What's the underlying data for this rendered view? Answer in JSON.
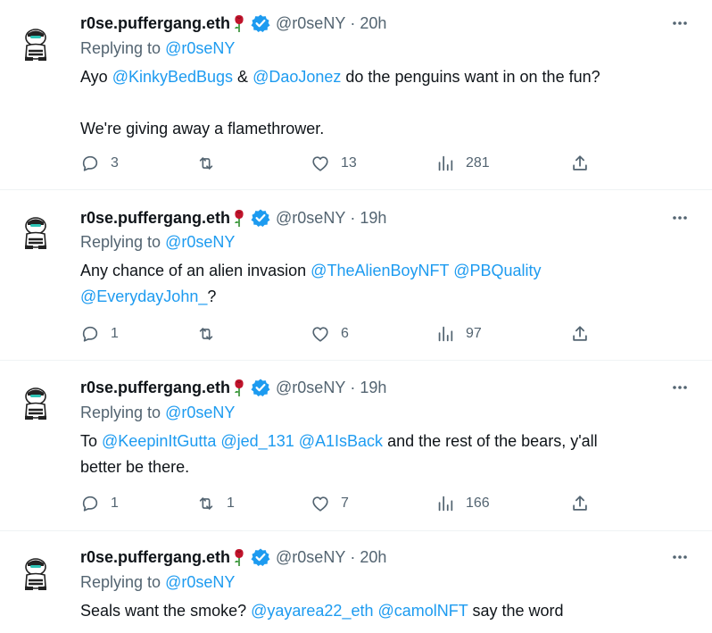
{
  "tweets": [
    {
      "name": "r0se.puffergang.eth",
      "handle": "@r0seNY",
      "dot": "·",
      "time": "20h",
      "replying_label": "Replying to ",
      "replying_to": "@r0seNY",
      "body_parts": [
        {
          "t": "Ayo "
        },
        {
          "t": "@KinkyBedBugs",
          "m": true
        },
        {
          "t": " & "
        },
        {
          "t": "@DaoJonez",
          "m": true
        },
        {
          "t": " do the penguins want in on the fun?"
        }
      ],
      "body_line2": "We're giving away a flamethrower.",
      "replies": "3",
      "retweets": "",
      "likes": "13",
      "views": "281"
    },
    {
      "name": "r0se.puffergang.eth",
      "handle": "@r0seNY",
      "dot": "·",
      "time": "19h",
      "replying_label": "Replying to ",
      "replying_to": "@r0seNY",
      "body_parts": [
        {
          "t": "Any chance of an alien invasion "
        },
        {
          "t": "@TheAlienBoyNFT",
          "m": true
        },
        {
          "t": " "
        },
        {
          "t": "@PBQuality",
          "m": true
        },
        {
          "t": " "
        },
        {
          "t": "@EverydayJohn_",
          "m": true
        },
        {
          "t": "?"
        }
      ],
      "body_line2": "",
      "replies": "1",
      "retweets": "",
      "likes": "6",
      "views": "97"
    },
    {
      "name": "r0se.puffergang.eth",
      "handle": "@r0seNY",
      "dot": "·",
      "time": "19h",
      "replying_label": "Replying to ",
      "replying_to": "@r0seNY",
      "body_parts": [
        {
          "t": "To "
        },
        {
          "t": "@KeepinItGutta",
          "m": true
        },
        {
          "t": " "
        },
        {
          "t": "@jed_131",
          "m": true
        },
        {
          "t": " "
        },
        {
          "t": "@A1IsBack",
          "m": true
        },
        {
          "t": " and the rest of the bears, y'all better be there."
        }
      ],
      "body_line2": "",
      "replies": "1",
      "retweets": "1",
      "likes": "7",
      "views": "166"
    },
    {
      "name": "r0se.puffergang.eth",
      "handle": "@r0seNY",
      "dot": "·",
      "time": "20h",
      "replying_label": "Replying to ",
      "replying_to": "@r0seNY",
      "body_parts": [
        {
          "t": "Seals want the smoke? "
        },
        {
          "t": "@yayarea22_eth",
          "m": true
        },
        {
          "t": " "
        },
        {
          "t": "@camolNFT",
          "m": true
        },
        {
          "t": " say the word"
        }
      ],
      "body_line2": "",
      "replies": "",
      "retweets": "",
      "likes": "",
      "views": ""
    }
  ],
  "colors": {
    "text": "#0f1419",
    "secondary": "#536471",
    "link": "#1d9bf0",
    "verified": "#1d9bf0",
    "rose": "#c0142b",
    "divider": "#eff3f4"
  }
}
